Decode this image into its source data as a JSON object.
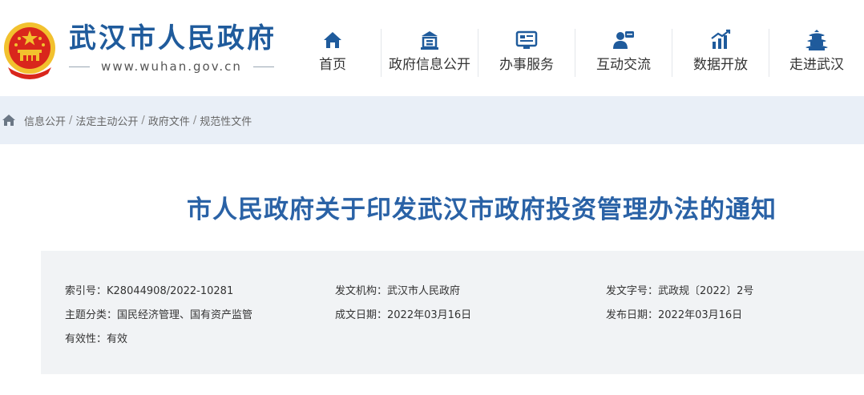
{
  "header": {
    "site_name": "武汉市人民政府",
    "site_url": "www.wuhan.gov.cn",
    "emblem_icon": "national-emblem-icon"
  },
  "nav": {
    "items": [
      {
        "label": "首页",
        "icon": "home-icon"
      },
      {
        "label": "政府信息公开",
        "icon": "building-icon"
      },
      {
        "label": "办事服务",
        "icon": "monitor-icon"
      },
      {
        "label": "互动交流",
        "icon": "user-chat-icon"
      },
      {
        "label": "数据开放",
        "icon": "bar-chart-icon"
      },
      {
        "label": "走进武汉",
        "icon": "tower-icon"
      }
    ]
  },
  "breadcrumb": {
    "items": [
      "信息公开",
      "法定主动公开",
      "政府文件",
      "规范性文件"
    ],
    "separator": "/"
  },
  "article": {
    "title": "市人民政府关于印发武汉市政府投资管理办法的通知"
  },
  "meta": {
    "index_no": {
      "label": "索引号：",
      "value": "K28044908/2022-10281"
    },
    "issuer": {
      "label": "发文机构：",
      "value": "武汉市人民政府"
    },
    "doc_no": {
      "label": "发文字号：",
      "value": "武政规〔2022〕2号"
    },
    "category": {
      "label": "主题分类：",
      "value": "国民经济管理、国有资产监管"
    },
    "written_date": {
      "label": "成文日期：",
      "value": "2022年03月16日"
    },
    "publish_date": {
      "label": "发布日期：",
      "value": "2022年03月16日"
    },
    "validity": {
      "label": "有效性：",
      "value": "有效"
    }
  },
  "colors": {
    "brand_blue": "#1f5b9c",
    "title_blue": "#2a62a6",
    "nav_icon": "#1f5b9c",
    "crumb_bg": "#e9eff7",
    "meta_bg": "#f1f3f5",
    "emblem_red": "#d9261c",
    "emblem_gold": "#f2c12e"
  }
}
